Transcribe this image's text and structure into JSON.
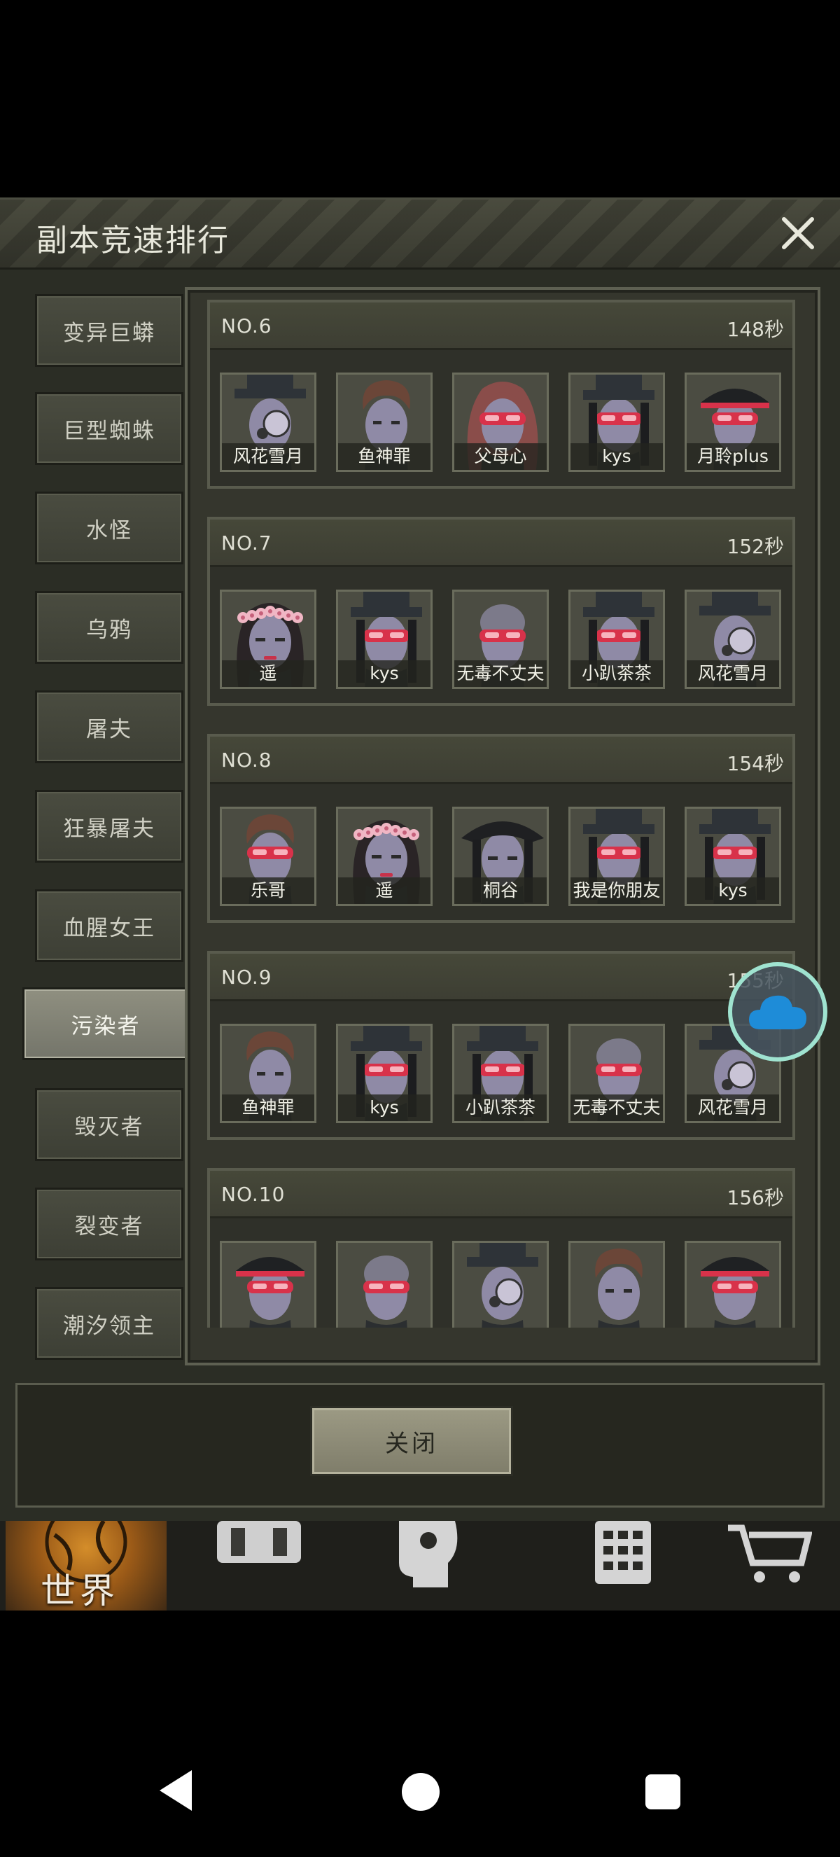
{
  "panel": {
    "title": "副本竞速排行",
    "close_label": "关闭"
  },
  "categories": [
    {
      "label": "变异巨蟒",
      "active": false
    },
    {
      "label": "巨型蜘蛛",
      "active": false
    },
    {
      "label": "水怪",
      "active": false
    },
    {
      "label": "乌鸦",
      "active": false
    },
    {
      "label": "屠夫",
      "active": false
    },
    {
      "label": "狂暴屠夫",
      "active": false
    },
    {
      "label": "血腥女王",
      "active": false
    },
    {
      "label": "污染者",
      "active": true
    },
    {
      "label": "毁灭者",
      "active": false
    },
    {
      "label": "裂变者",
      "active": false
    },
    {
      "label": "潮汐领主",
      "active": false
    }
  ],
  "rankings": [
    {
      "no": "NO.6",
      "time": "148秒",
      "members": [
        {
          "name": "风花雪月",
          "avatar": "masked-hat-avatar"
        },
        {
          "name": "鱼神罪",
          "avatar": "brown-hair-avatar"
        },
        {
          "name": "父母心",
          "avatar": "ponytail-avatar"
        },
        {
          "name": "kys",
          "avatar": "hat-goggles-avatar"
        },
        {
          "name": "月聆plus",
          "avatar": "officer-cap-avatar"
        }
      ]
    },
    {
      "no": "NO.7",
      "time": "152秒",
      "members": [
        {
          "name": "遥",
          "avatar": "flower-crown-avatar"
        },
        {
          "name": "kys",
          "avatar": "hat-goggles-avatar"
        },
        {
          "name": "无毒不丈夫",
          "avatar": "bald-goggles-avatar"
        },
        {
          "name": "小趴茶茶",
          "avatar": "hat-goggles-avatar"
        },
        {
          "name": "风花雪月",
          "avatar": "masked-hat-avatar"
        }
      ]
    },
    {
      "no": "NO.8",
      "time": "154秒",
      "members": [
        {
          "name": "乐哥",
          "avatar": "brown-hair-goggles-avatar"
        },
        {
          "name": "遥",
          "avatar": "flower-crown-avatar"
        },
        {
          "name": "桐谷",
          "avatar": "pirate-hat-avatar"
        },
        {
          "name": "我是你朋友",
          "avatar": "hat-goggles-avatar"
        },
        {
          "name": "kys",
          "avatar": "hat-goggles-avatar"
        }
      ]
    },
    {
      "no": "NO.9",
      "time": "155秒",
      "members": [
        {
          "name": "鱼神罪",
          "avatar": "brown-hair-avatar"
        },
        {
          "name": "kys",
          "avatar": "hat-goggles-avatar"
        },
        {
          "name": "小趴茶茶",
          "avatar": "hat-goggles-avatar"
        },
        {
          "name": "无毒不丈夫",
          "avatar": "bald-goggles-avatar"
        },
        {
          "name": "风花雪月",
          "avatar": "masked-hat-avatar"
        }
      ]
    },
    {
      "no": "NO.10",
      "time": "156秒",
      "members": [
        {
          "name": "",
          "avatar": "officer-cap-avatar"
        },
        {
          "name": "",
          "avatar": "bald-goggles-avatar"
        },
        {
          "name": "",
          "avatar": "masked-hat-avatar"
        },
        {
          "name": "",
          "avatar": "brown-hair-avatar"
        },
        {
          "name": "",
          "avatar": "officer-cap-avatar"
        }
      ]
    }
  ],
  "bottom_nav": {
    "world_label": "世界",
    "tabs": [
      "globe-icon",
      "backpack-icon",
      "head-gear-icon",
      "calculator-icon",
      "cart-icon"
    ]
  },
  "colors": {
    "panel_bg": "#2b2d25",
    "active_tab": "#8f8f80",
    "cloud_ring": "#9fe3d0",
    "cloud_fill": "#1e8cd8"
  }
}
